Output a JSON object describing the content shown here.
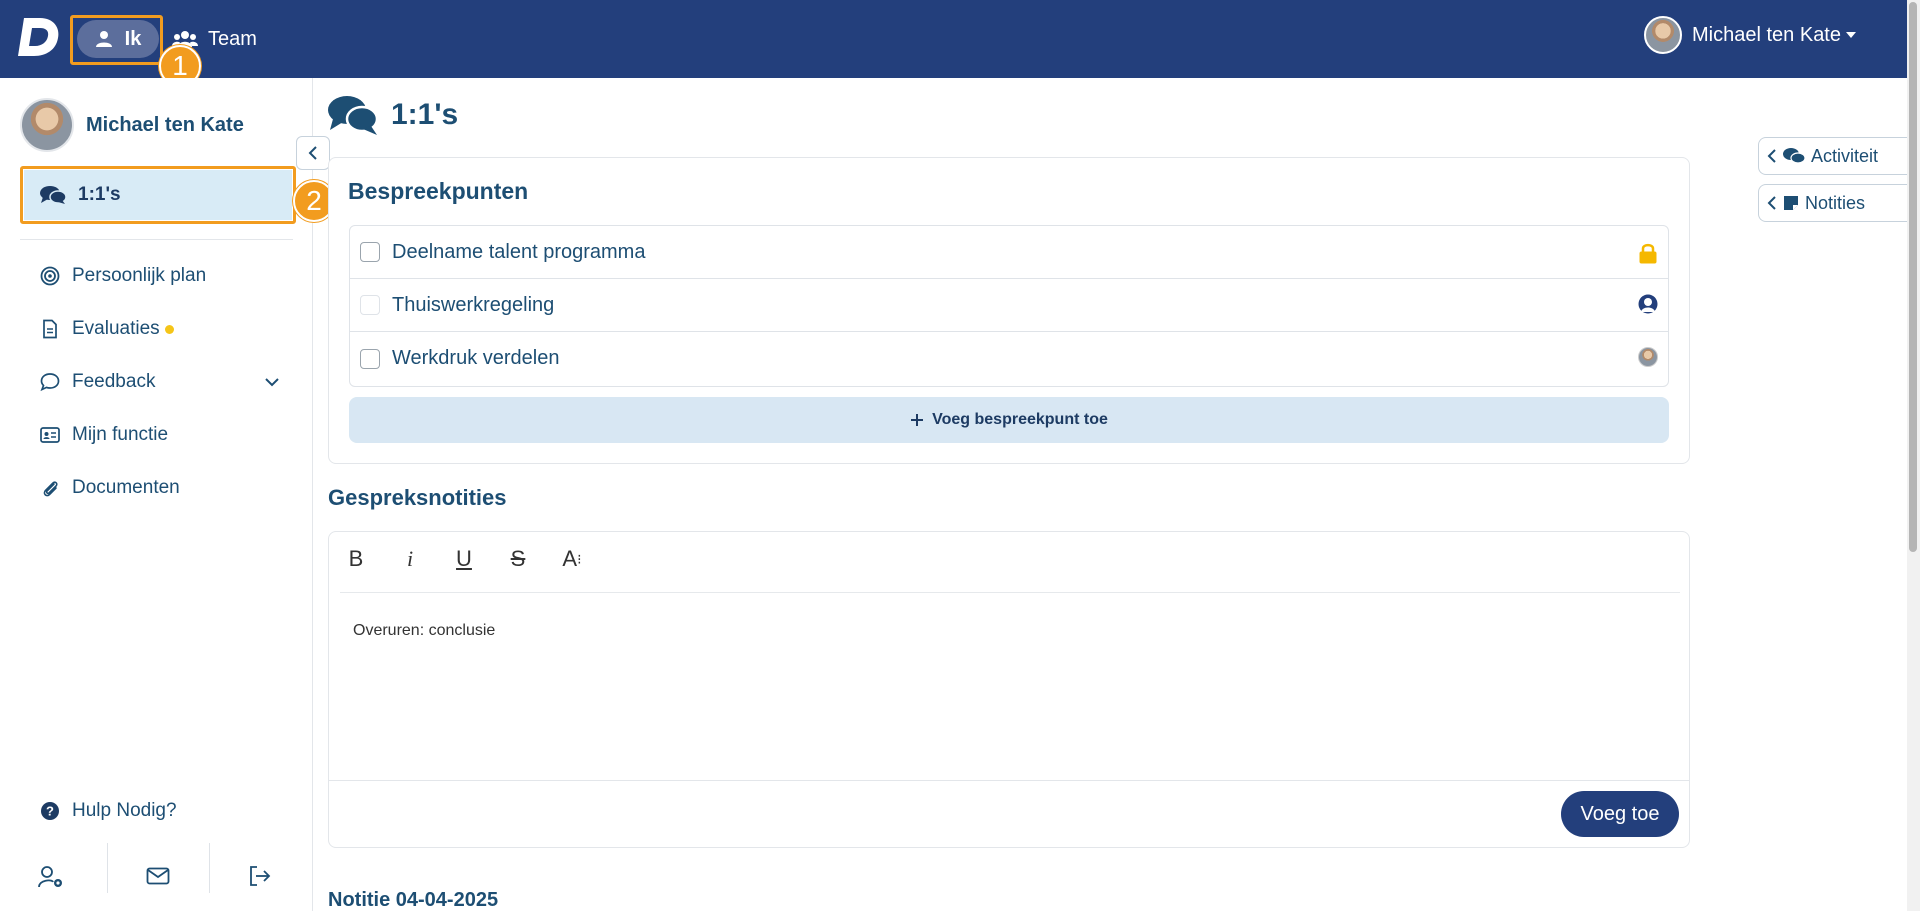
{
  "topbar": {
    "nav_me": "Ik",
    "nav_team": "Team",
    "user_name": "Michael ten Kate"
  },
  "badges": [
    "1",
    "2"
  ],
  "sidebar": {
    "user_name": "Michael ten Kate",
    "active_item": "1:1's",
    "items": [
      {
        "label": "Persoonlijk plan",
        "icon": "target-icon"
      },
      {
        "label": "Evaluaties",
        "icon": "document-icon",
        "dot": true
      },
      {
        "label": "Feedback",
        "icon": "speech-bubble-icon",
        "chevron": true
      },
      {
        "label": "Mijn functie",
        "icon": "id-card-icon"
      },
      {
        "label": "Documenten",
        "icon": "paperclip-icon"
      }
    ],
    "help": "Hulp Nodig?"
  },
  "main": {
    "title": "1:1's",
    "discussion_title": "Bespreekpunten",
    "points": [
      {
        "label": "Deelname talent programma",
        "icon": "lock-icon"
      },
      {
        "label": "Thuiswerkregeling",
        "icon": "user-avatar-icon"
      },
      {
        "label": "Werkdruk verdelen",
        "icon": "user-photo-icon"
      }
    ],
    "add_point": "Voeg bespreekpunt toe",
    "notes_title": "Gespreksnotities",
    "editor_text": "Overuren: conclusie",
    "add_button": "Voeg toe",
    "note_title": "Notitie 04-04-2025"
  },
  "right_tabs": {
    "activity": "Activiteit",
    "notes": "Notities"
  },
  "colors": {
    "primary": "#233f7c",
    "highlight": "#f29c1f",
    "active_bg": "#d8ebf6",
    "text": "#1d4e73"
  }
}
